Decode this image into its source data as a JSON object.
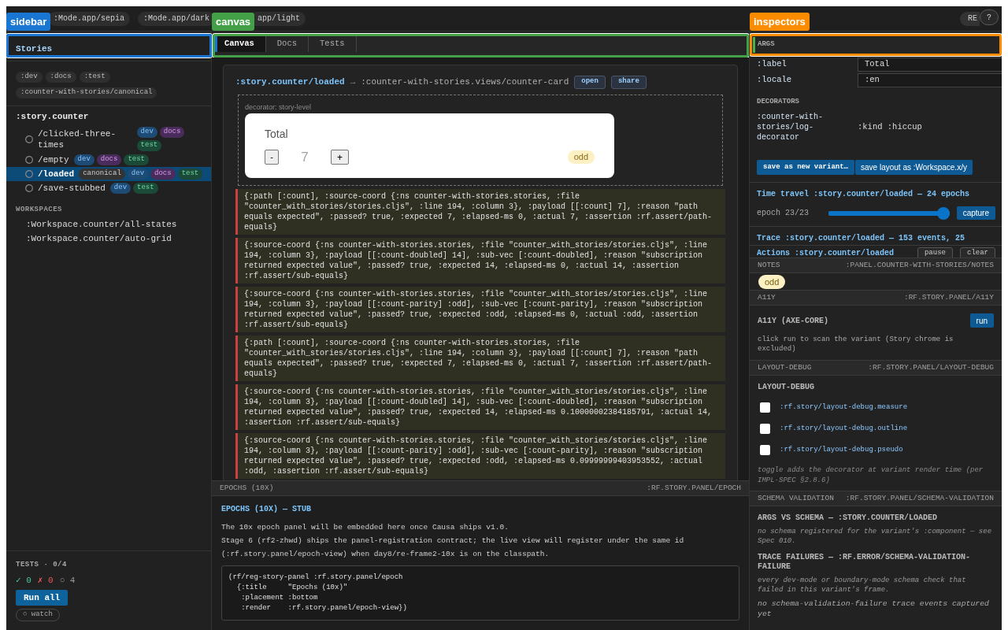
{
  "overlays": [
    {
      "label": "sidebar",
      "color": "#1976d2"
    },
    {
      "label": "canvas",
      "color": "#43a047"
    },
    {
      "label": "inspectors",
      "color": "#fb8c00"
    }
  ],
  "top_bar": {
    "modes": [
      {
        "label": ":Mode.app/sepia",
        "kind": "pill"
      },
      {
        "label": ":Mode.app/dark",
        "kind": "pill"
      },
      {
        "label": "app/light",
        "kind": "clipped"
      }
    ],
    "reset": "RE",
    "help": "?"
  },
  "sidebar": {
    "title": "Stories",
    "filters": [
      ":dev",
      ":docs",
      ":test",
      ":counter-with-stories/canonical"
    ],
    "group": ":story.counter",
    "stories": [
      {
        "label": "/clicked-three-times",
        "selected": false,
        "tags": [
          {
            "label": "dev",
            "kind": "dev"
          },
          {
            "label": "docs",
            "kind": "docs"
          },
          {
            "label": "test",
            "kind": "test"
          }
        ]
      },
      {
        "label": "/empty",
        "selected": false,
        "tags": [
          {
            "label": "dev",
            "kind": "dev"
          },
          {
            "label": "docs",
            "kind": "docs"
          },
          {
            "label": "test",
            "kind": "test"
          }
        ]
      },
      {
        "label": "/loaded",
        "selected": true,
        "tags": [
          {
            "label": "canonical",
            "kind": "canonical"
          },
          {
            "label": "dev",
            "kind": "dev"
          },
          {
            "label": "docs",
            "kind": "docs"
          },
          {
            "label": "test",
            "kind": "test"
          }
        ]
      },
      {
        "label": "/save-stubbed",
        "selected": false,
        "tags": [
          {
            "label": "dev",
            "kind": "dev"
          },
          {
            "label": "test",
            "kind": "test"
          }
        ]
      }
    ],
    "workspaces_heading": "WORKSPACES",
    "workspaces": [
      ":Workspace.counter/all-states",
      ":Workspace.counter/auto-grid"
    ],
    "tests": {
      "heading": "TESTS · 0/4",
      "counts": [
        {
          "kind": "pass",
          "icon": "✓",
          "value": "0"
        },
        {
          "kind": "fail",
          "icon": "✗",
          "value": "0"
        },
        {
          "kind": "pending",
          "icon": "○",
          "value": "4"
        }
      ],
      "run_all": "Run all",
      "watch": "○ watch"
    }
  },
  "canvas": {
    "tabs": [
      {
        "label": "Canvas",
        "selected": true
      },
      {
        "label": "Docs",
        "selected": false
      },
      {
        "label": "Tests",
        "selected": false
      }
    ],
    "story": ":story.counter/loaded",
    "arrow": "→",
    "component": ":counter-with-stories.views/counter-card",
    "actions": [
      "open",
      "share"
    ],
    "decorator": "decorator: story-level",
    "counter": {
      "title": "Total",
      "decrement": "-",
      "value": "7",
      "increment": "+",
      "parity": "odd"
    },
    "log": [
      "{:path [:count], :source-coord {:ns counter-with-stories.stories, :file \"counter_with_stories/stories.cljs\", :line 194, :column 3}, :payload [[:count] 7], :reason \"path equals expected\", :passed? true, :expected 7, :elapsed-ms 0, :actual 7, :assertion :rf.assert/path-equals}",
      "{:source-coord {:ns counter-with-stories.stories, :file \"counter_with_stories/stories.cljs\", :line 194, :column 3}, :payload [[:count-doubled] 14], :sub-vec [:count-doubled], :reason \"subscription returned expected value\", :passed? true, :expected 14, :elapsed-ms 0, :actual 14, :assertion :rf.assert/sub-equals}",
      "{:source-coord {:ns counter-with-stories.stories, :file \"counter_with_stories/stories.cljs\", :line 194, :column 3}, :payload [[:count-parity] :odd], :sub-vec [:count-parity], :reason \"subscription returned expected value\", :passed? true, :expected :odd, :elapsed-ms 0, :actual :odd, :assertion :rf.assert/sub-equals}",
      "{:path [:count], :source-coord {:ns counter-with-stories.stories, :file \"counter_with_stories/stories.cljs\", :line 194, :column 3}, :payload [[:count] 7], :reason \"path equals expected\", :passed? true, :expected 7, :elapsed-ms 0, :actual 7, :assertion :rf.assert/path-equals}",
      "{:source-coord {:ns counter-with-stories.stories, :file \"counter_with_stories/stories.cljs\", :line 194, :column 3}, :payload [[:count-doubled] 14], :sub-vec [:count-doubled], :reason \"subscription returned expected value\", :passed? true, :expected 14, :elapsed-ms 0.10000002384185791, :actual 14, :assertion :rf.assert/sub-equals}",
      "{:source-coord {:ns counter-with-stories.stories, :file \"counter_with_stories/stories.cljs\", :line 194, :column 3}, :payload [[:count-parity] :odd], :sub-vec [:count-parity], :reason \"subscription returned expected value\", :passed? true, :expected :odd, :elapsed-ms 0.09999999403953552, :actual :odd, :assertion :rf.assert/sub-equals}"
    ]
  },
  "epochs_panel": {
    "title": "EPOCHS (10X)",
    "id": ":RF.STORY.PANEL/EPOCH",
    "heading": "EPOCHS (10X) — STUB",
    "paragraphs": [
      "The 10x epoch panel will be embedded here once Causa ships v1.0.",
      "Stage 6 (rf2-zhwd) ships the panel-registration contract; the live view will register under the same id (:rf.story.panel/epoch-view) when day8/re-frame2-10x is on the classpath."
    ],
    "code": "(rf/reg-story-panel :rf.story.panel/epoch\n  {:title     \"Epochs (10x)\"\n   :placement :bottom\n   :render    :rf.story.panel/epoch-view})"
  },
  "inspectors": {
    "args_heading": "ARGS",
    "args": [
      {
        "name": ":label",
        "value": "Total"
      },
      {
        "name": ":locale",
        "value": ":en"
      }
    ],
    "decorators_heading": "DECORATORS",
    "decorators": [
      {
        "name": ":counter-with-stories/log-decorator",
        "value": ":kind :hiccup"
      }
    ],
    "save_variant": "save as new variant…",
    "save_layout": "save layout as :Workspace.x/y",
    "time_travel": {
      "title": "Time travel :story.counter/loaded — 24 epochs",
      "epoch": "epoch 23/23",
      "level": 1,
      "capture": "capture"
    },
    "trace": "Trace :story.counter/loaded — 153 events, 25",
    "actions": {
      "title": "Actions :story.counter/loaded",
      "buttons": [
        "pause",
        "clear"
      ]
    }
  },
  "panels": [
    {
      "kind": "notes",
      "title": "NOTES",
      "id": ":PANEL.COUNTER-WITH-STORIES/NOTES",
      "badge": "odd"
    },
    {
      "kind": "a11y",
      "title": "A11Y",
      "id": ":RF.STORY.PANEL/A11Y",
      "heading": "A11Y (AXE-CORE)",
      "button": "run",
      "text": "click run to scan the variant (Story chrome is excluded)"
    },
    {
      "kind": "layout_debug",
      "title": "LAYOUT-DEBUG",
      "id": ":RF.STORY.PANEL/LAYOUT-DEBUG",
      "heading": "LAYOUT-DEBUG",
      "options": [
        {
          "label": ":rf.story/layout-debug.measure",
          "checked": false
        },
        {
          "label": ":rf.story/layout-debug.outline",
          "checked": false
        },
        {
          "label": ":rf.story/layout-debug.pseudo",
          "checked": false
        }
      ],
      "note": "toggle adds the decorator at variant render time (per IMPL-SPEC §2.8.6)"
    },
    {
      "kind": "schema",
      "title": "SCHEMA VALIDATION",
      "id": ":RF.STORY.PANEL/SCHEMA-VALIDATION",
      "sections": [
        {
          "heading": "ARGS VS SCHEMA — :STORY.COUNTER/LOADED",
          "note": "no schema registered for the variant's :component — see Spec 010."
        },
        {
          "heading": "TRACE FAILURES — :RF.ERROR/SCHEMA-VALIDATION-FAILURE",
          "note": "every dev-mode or boundary-mode schema check that failed in this variant's frame."
        }
      ],
      "empty": "no schema-validation-failure trace events captured yet"
    }
  ]
}
